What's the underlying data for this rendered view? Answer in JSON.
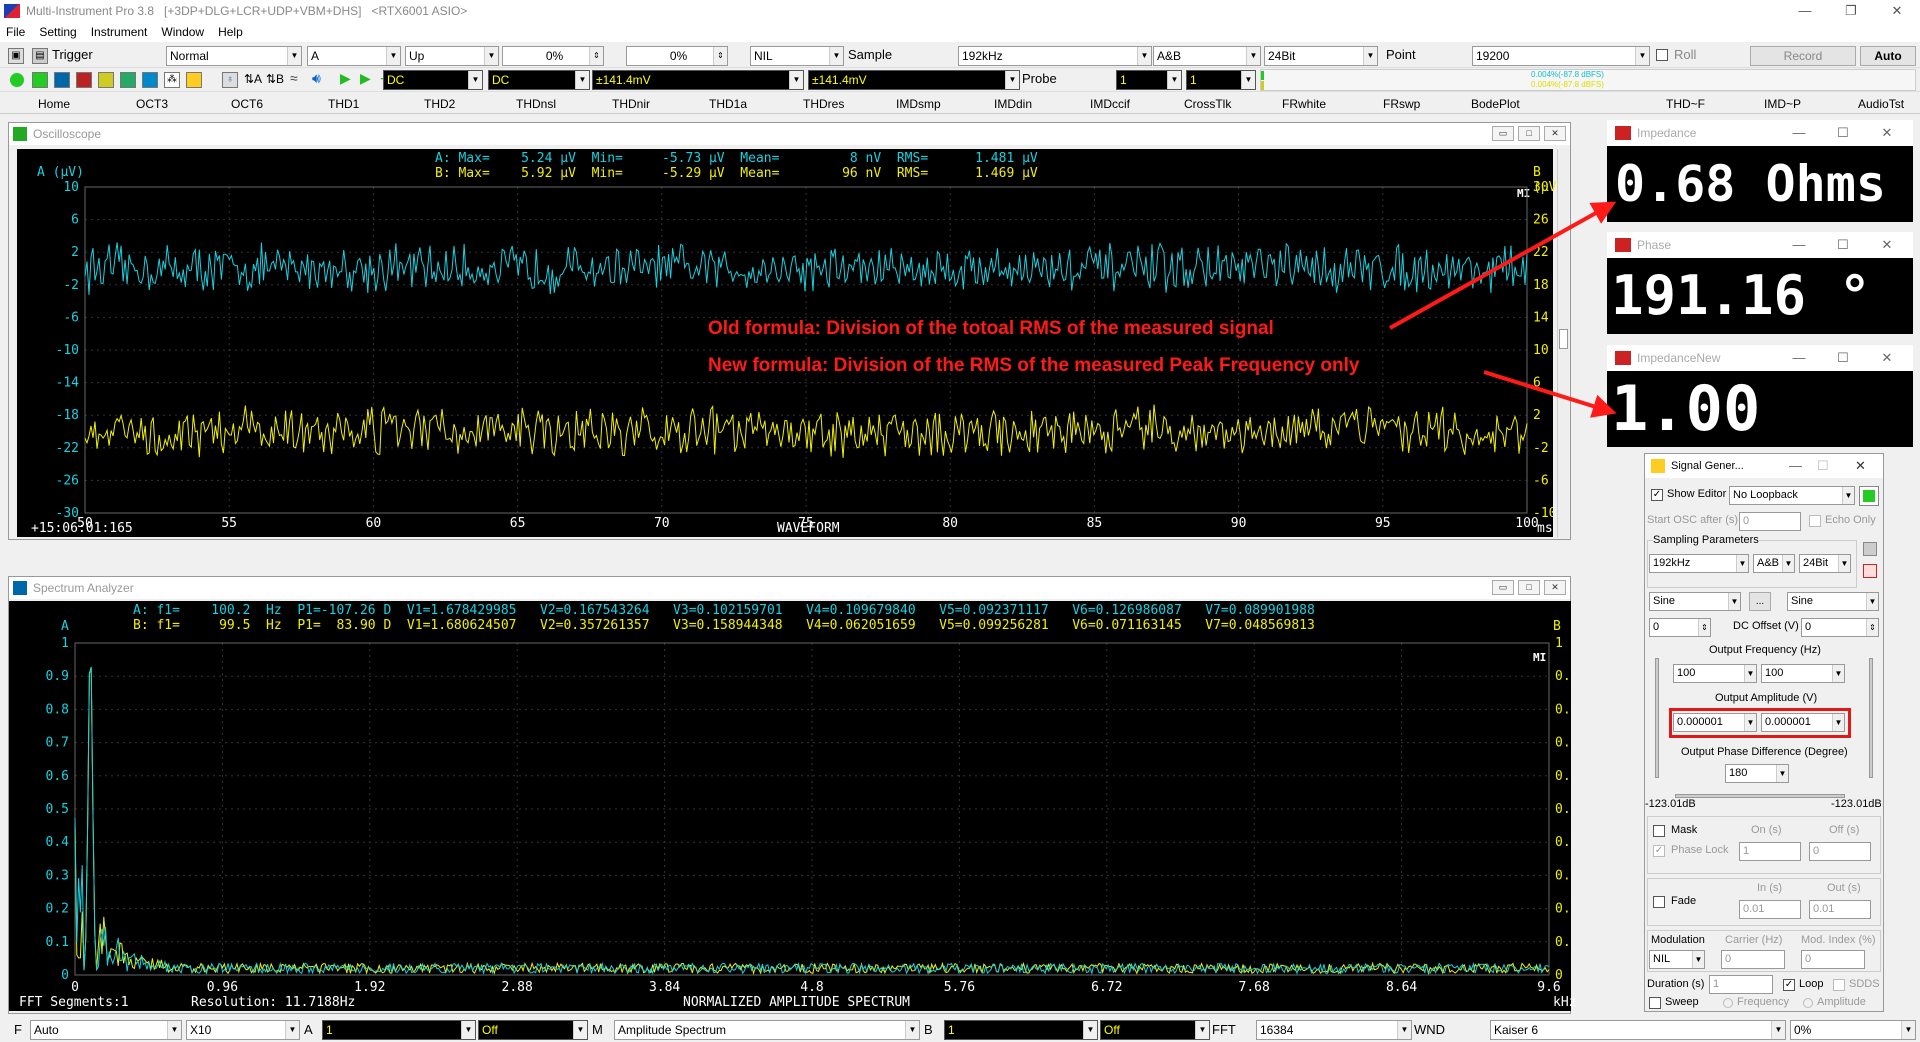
{
  "window": {
    "title": "Multi-Instrument Pro 3.8",
    "config": "[+3DP+DLG+LCR+UDP+VBM+DHS]",
    "device": "<RTX6001 ASIO>"
  },
  "menu": [
    "File",
    "Setting",
    "Instrument",
    "Window",
    "Help"
  ],
  "toolbar1": {
    "trigger_label": "Trigger",
    "mode": "Normal",
    "channel": "A",
    "edge": "Up",
    "pct1": "0%",
    "pct2": "0%",
    "nil": "NIL",
    "sample_label": "Sample",
    "sample_rate": "192kHz",
    "channels": "A&B",
    "bits": "24Bit",
    "point_label": "Point",
    "points": "19200",
    "roll_label": "Roll",
    "record_label": "Record",
    "auto_label": "Auto"
  },
  "toolbar2": {
    "coupling_a": "DC",
    "coupling_b": "DC",
    "range_a": "±141.4mV",
    "range_b": "±141.4mV",
    "probe_label": "Probe",
    "probe_a": "1",
    "probe_b": "1",
    "meter_top": "0.004%(-87.8 dBFS)",
    "meter_bot": "0.004%(-87.8 dBFS)"
  },
  "tabs": [
    "Home",
    "OCT3",
    "OCT6",
    "THD1",
    "THD2",
    "THDnsl",
    "THDnir",
    "THD1a",
    "THDres",
    "IMDsmp",
    "IMDdin",
    "IMDccif",
    "CrossTlk",
    "FRwhite",
    "FRswp",
    "BodePlot",
    "THD~F",
    "IMD~P",
    "AudioTst"
  ],
  "osc": {
    "title": "Oscilloscope",
    "a_stats": [
      "A: Max=",
      "5.24 µV",
      "Min=",
      "-5.73 µV",
      "Mean=",
      "8 nV",
      "RMS=",
      "1.481 µV"
    ],
    "b_stats": [
      "B: Max=",
      "5.92 µV",
      "Min=",
      "-5.29 µV",
      "Mean=",
      "96 nV",
      "RMS=",
      "1.469 µV"
    ],
    "a_unit": "A (µV)",
    "b_unit": "B (µV)",
    "mi": "MI",
    "timestamp": "+15:06:01:165",
    "label": "WAVEFORM",
    "xunit": "ms",
    "left_ticks": [
      "10",
      "6",
      "2",
      "-2",
      "-6",
      "-10",
      "-14",
      "-18",
      "-22",
      "-26",
      "-30"
    ],
    "right_ticks": [
      "30",
      "26",
      "22",
      "18",
      "14",
      "10",
      "6",
      "2",
      "-2",
      "-6",
      "-10"
    ],
    "x_ticks": [
      "50",
      "55",
      "60",
      "65",
      "70",
      "75",
      "80",
      "85",
      "90",
      "95",
      "100"
    ]
  },
  "spec": {
    "title": "Spectrum Analyzer",
    "a_line": "A: f1=    100.2  Hz  P1=-107.26 D  V1=1.678429985   V2=0.167543264   V3=0.102159701   V4=0.109679840   V5=0.092371117   V6=0.126986087   V7=0.089901988",
    "b_line": "B: f1=     99.5  Hz  P1=  83.90 D  V1=1.680624507   V2=0.357261357   V3=0.158944348   V4=0.062051659   V5=0.099256281   V6=0.071163145   V7=0.048569813",
    "a_lbl": "A",
    "b_lbl": "B",
    "mi": "MI",
    "y_ticks": [
      "1",
      "0.9",
      "0.8",
      "0.7",
      "0.6",
      "0.5",
      "0.4",
      "0.3",
      "0.2",
      "0.1",
      "0"
    ],
    "x_ticks": [
      "0",
      "0.96",
      "1.92",
      "2.88",
      "3.84",
      "4.8",
      "5.76",
      "6.72",
      "7.68",
      "8.64",
      "9.6"
    ],
    "xunit": "kHz",
    "segments": "FFT Segments:1",
    "resolution": "Resolution: 11.7188Hz",
    "label": "NORMALIZED AMPLITUDE SPECTRUM"
  },
  "impedance": {
    "title": "Impedance",
    "value": "0.68 Ohms"
  },
  "phase": {
    "title": "Phase",
    "value": "191.16 °"
  },
  "impedance_new": {
    "title": "ImpedanceNew",
    "value": "1.00"
  },
  "annotations": {
    "old": "Old formula: Division of the totoal RMS of the measured signal",
    "new": "New formula: Division of the RMS of the measured Peak Frequency only"
  },
  "siggen": {
    "title": "Signal Gener...",
    "show_editor": "Show Editor",
    "loopback": "No Loopback",
    "start_osc": "Start OSC after (s)",
    "start_val": "0",
    "echo_only": "Echo Only",
    "sampling_params": "Sampling Parameters",
    "rate": "192kHz",
    "ch": "A&B",
    "bits": "24Bit",
    "wave_a": "Sine",
    "wave_b": "Sine",
    "dots": "...",
    "dc_a": "0",
    "dc_label": "DC Offset (V)",
    "dc_b": "0",
    "freq_label": "Output Frequency (Hz)",
    "freq_a": "100",
    "freq_b": "100",
    "amp_label": "Output Amplitude (V)",
    "amp_a": "0.000001",
    "amp_b": "0.000001",
    "phase_label": "Output Phase Difference (Degree)",
    "phase_val": "180",
    "db_a": "-123.01dB",
    "db_b": "-123.01dB",
    "mask": "Mask",
    "on_s": "On (s)",
    "off_s": "Off (s)",
    "phase_lock": "Phase Lock",
    "mask_on": "1",
    "mask_off": "0",
    "fade": "Fade",
    "in_s": "In (s)",
    "out_s": "Out (s)",
    "fade_in": "0.01",
    "fade_out": "0.01",
    "modulation": "Modulation",
    "carrier": "Carrier (Hz)",
    "mod_index": "Mod. Index (%)",
    "mod": "NIL",
    "carrier_val": "0",
    "mod_index_val": "0",
    "duration": "Duration (s)",
    "duration_val": "1",
    "loop": "Loop",
    "sdds": "SDDS",
    "sweep": "Sweep",
    "frequency": "Frequency",
    "amplitude": "Amplitude"
  },
  "status": {
    "f_lbl": "F",
    "f_mode": "Auto",
    "zoom": "X10",
    "a_lbl": "A",
    "a_val": "1",
    "a_off": "Off",
    "m_lbl": "M",
    "m_val": "Amplitude Spectrum",
    "b_lbl": "B",
    "b_val": "1",
    "b_off": "Off",
    "fft_lbl": "FFT",
    "fft_val": "16384",
    "wnd_lbl": "WND",
    "wnd_val": "Kaiser 6",
    "pct": "0%"
  },
  "colors": {
    "cyan": "#19d0e0",
    "yellow": "#f0f000",
    "annotation": "#ff1a1a"
  }
}
